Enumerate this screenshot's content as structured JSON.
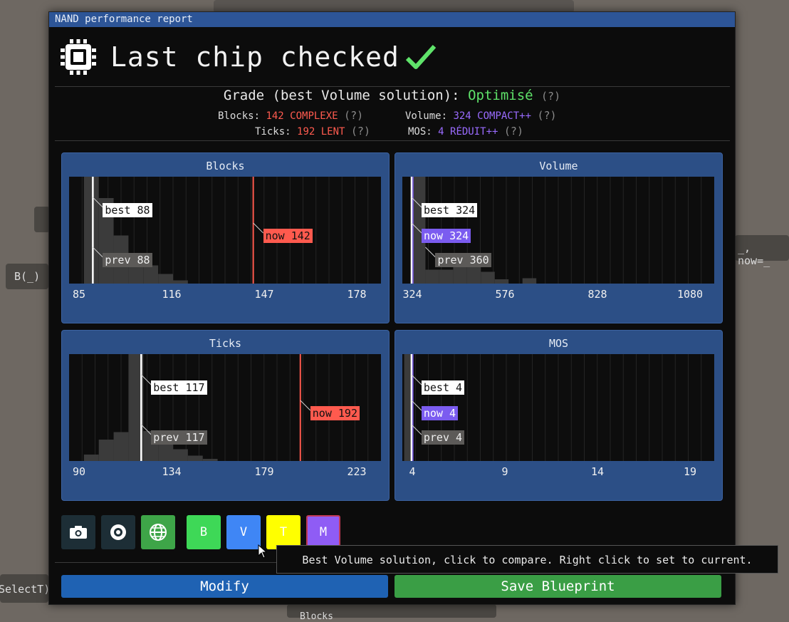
{
  "background": {
    "frag1": "B(_)",
    "frag2": "_, now=_",
    "frag3": "SelectT)",
    "frag4": "Blocks"
  },
  "window": {
    "title": "NAND performance report"
  },
  "header": {
    "title": "Last chip checked",
    "chip_icon": "chip-icon",
    "status_icon": "checkmark-icon"
  },
  "grade": {
    "label": "Grade (best Volume solution):",
    "value": "Optimisé",
    "help": "(?)",
    "value_color": "#5fe36a"
  },
  "stats": {
    "blocks_label": "Blocks:",
    "blocks_value": "142 COMPLEXE",
    "blocks_help": "(?)",
    "volume_label": "Volume:",
    "volume_value": "324 COMPACT++",
    "volume_help": "(?)",
    "ticks_label": "Ticks:",
    "ticks_value": "192 LENT",
    "ticks_help": "(?)",
    "mos_label": "MOS:",
    "mos_value": "4 RÉDUIT++",
    "mos_help": "(?)"
  },
  "chart_data": [
    {
      "type": "bar",
      "title": "Blocks",
      "x_ticks": [
        "85",
        "116",
        "147",
        "178"
      ],
      "xlim": [
        80,
        185
      ],
      "histogram": [
        {
          "x": 85,
          "y": 1.0
        },
        {
          "x": 90,
          "y": 0.8
        },
        {
          "x": 95,
          "y": 0.45
        },
        {
          "x": 100,
          "y": 0.28
        },
        {
          "x": 105,
          "y": 0.17
        },
        {
          "x": 110,
          "y": 0.09
        },
        {
          "x": 115,
          "y": 0.03
        }
      ],
      "bin_width": 5,
      "markers": {
        "best": {
          "label": "best 88",
          "x": 88
        },
        "now": {
          "label": "now 142",
          "x": 142,
          "style": "red"
        },
        "prev": {
          "label": "prev 88",
          "x": 88
        }
      }
    },
    {
      "type": "bar",
      "title": "Volume",
      "x_ticks": [
        "324",
        "576",
        "828",
        "1080"
      ],
      "xlim": [
        300,
        1110
      ],
      "histogram": [
        {
          "x": 324,
          "y": 1.0
        },
        {
          "x": 360,
          "y": 0.13
        },
        {
          "x": 396,
          "y": 0.13
        },
        {
          "x": 432,
          "y": 0.26
        },
        {
          "x": 468,
          "y": 0.2
        },
        {
          "x": 504,
          "y": 0.11
        },
        {
          "x": 540,
          "y": 0.04
        },
        {
          "x": 612,
          "y": 0.05
        }
      ],
      "bin_width": 36,
      "markers": {
        "best": {
          "label": "best 324",
          "x": 324
        },
        "now": {
          "label": "now 324",
          "x": 324,
          "style": "purple"
        },
        "prev": {
          "label": "prev 360",
          "x": 360
        }
      }
    },
    {
      "type": "bar",
      "title": "Ticks",
      "x_ticks": [
        "90",
        "134",
        "179",
        "223"
      ],
      "xlim": [
        83,
        230
      ],
      "histogram": [
        {
          "x": 90,
          "y": 0.06
        },
        {
          "x": 97,
          "y": 0.2
        },
        {
          "x": 104,
          "y": 0.27
        },
        {
          "x": 111,
          "y": 1.0
        },
        {
          "x": 118,
          "y": 0.28
        },
        {
          "x": 125,
          "y": 0.17
        },
        {
          "x": 132,
          "y": 0.11
        },
        {
          "x": 139,
          "y": 0.05
        },
        {
          "x": 146,
          "y": 0.02
        }
      ],
      "bin_width": 7,
      "markers": {
        "best": {
          "label": "best 117",
          "x": 117
        },
        "now": {
          "label": "now 192",
          "x": 192,
          "style": "red"
        },
        "prev": {
          "label": "prev 117",
          "x": 117
        }
      }
    },
    {
      "type": "bar",
      "title": "MOS",
      "x_ticks": [
        "4",
        "9",
        "14",
        "19"
      ],
      "xlim": [
        3.5,
        20.5
      ],
      "histogram": [
        {
          "x": 3.6,
          "y": 1.0
        }
      ],
      "bin_width": 0.35,
      "markers": {
        "best": {
          "label": "best 4",
          "x": 4
        },
        "now": {
          "label": "now 4",
          "x": 4,
          "style": "purple"
        },
        "prev": {
          "label": "prev 4",
          "x": 4
        }
      }
    }
  ],
  "toolbar": {
    "camera_icon": "camera-icon",
    "view_icon": "eye-icon",
    "globe_icon": "globe-icon",
    "b_label": "B",
    "v_label": "V",
    "t_label": "T",
    "m_label": "M",
    "b_color": "#3ed857",
    "v_color": "#3f86f5",
    "t_color": "#ffff00",
    "m_color": "#8f5cf5"
  },
  "tooltip": {
    "text": "Best Volume solution, click to compare. Right click to set to current."
  },
  "actions": {
    "modify_label": "Modify",
    "save_label": "Save Blueprint"
  }
}
